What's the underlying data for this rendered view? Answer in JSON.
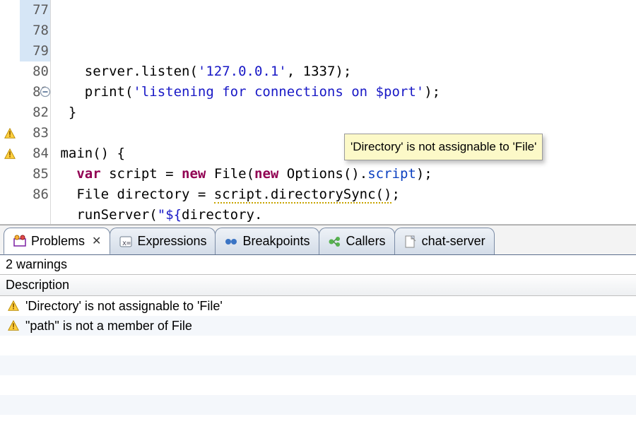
{
  "editor": {
    "fold_line": 81,
    "lines": [
      {
        "num": 77,
        "warn": false,
        "segs": [
          [
            "plain",
            "    server.listen("
          ],
          [
            "str",
            "'127.0.0.1'"
          ],
          [
            "plain",
            ", "
          ],
          [
            "num",
            "1337"
          ],
          [
            "plain",
            ");"
          ]
        ]
      },
      {
        "num": 78,
        "warn": false,
        "segs": [
          [
            "plain",
            "    print("
          ],
          [
            "str",
            "'listening for connections on $port'"
          ],
          [
            "plain",
            ");"
          ]
        ]
      },
      {
        "num": 79,
        "warn": false,
        "segs": [
          [
            "plain",
            "  }"
          ]
        ]
      },
      {
        "num": 80,
        "warn": false,
        "segs": [
          [
            "plain",
            ""
          ]
        ]
      },
      {
        "num": 81,
        "warn": false,
        "segs": [
          [
            "plain",
            " main() {"
          ]
        ]
      },
      {
        "num": 82,
        "warn": false,
        "segs": [
          [
            "plain",
            "   "
          ],
          [
            "kw",
            "var"
          ],
          [
            "plain",
            " script = "
          ],
          [
            "kw",
            "new"
          ],
          [
            "plain",
            " File("
          ],
          [
            "kw",
            "new"
          ],
          [
            "plain",
            " Options()."
          ],
          [
            "field",
            "script"
          ],
          [
            "plain",
            ");"
          ]
        ]
      },
      {
        "num": 83,
        "warn": true,
        "segs": [
          [
            "plain",
            "   File directory = "
          ],
          [
            "warnspan",
            "script.directorySync()"
          ],
          [
            "plain",
            ";"
          ]
        ]
      },
      {
        "num": 84,
        "warn": true,
        "segs": [
          [
            "plain",
            "   runServer("
          ],
          [
            "str",
            "\"${"
          ],
          [
            "plain",
            "directory."
          ]
        ]
      },
      {
        "num": 85,
        "warn": false,
        "segs": [
          [
            "plain",
            "  }"
          ]
        ]
      },
      {
        "num": 86,
        "warn": false,
        "segs": [
          [
            "plain",
            ""
          ]
        ]
      }
    ],
    "tooltip": "'Directory' is not assignable to 'File'",
    "highlight_nums": [
      77,
      78,
      79
    ]
  },
  "panel": {
    "tabs": [
      {
        "label": "Problems",
        "icon": "problems",
        "active": true,
        "closable": true
      },
      {
        "label": "Expressions",
        "icon": "expressions",
        "active": false,
        "closable": false
      },
      {
        "label": "Breakpoints",
        "icon": "breakpoints",
        "active": false,
        "closable": false
      },
      {
        "label": "Callers",
        "icon": "callers",
        "active": false,
        "closable": false
      },
      {
        "label": "chat-server",
        "icon": "file",
        "active": false,
        "closable": false
      }
    ],
    "status": "2 warnings",
    "column_header": "Description",
    "problems": [
      "'Directory' is not assignable to 'File'",
      "\"path\" is not a member of File"
    ]
  }
}
